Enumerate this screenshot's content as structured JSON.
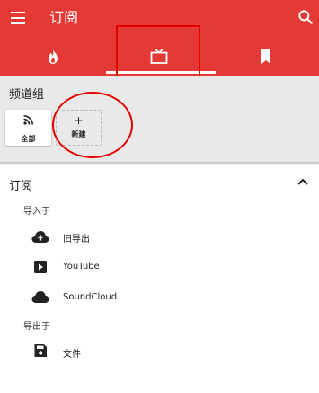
{
  "app": {
    "title": "订阅",
    "brand_color": "#e53935",
    "menu_icon": "menu-icon",
    "search_icon": "search-icon"
  },
  "tabs": [
    {
      "icon": "fire-icon",
      "selected": false
    },
    {
      "icon": "tv-icon",
      "selected": true
    },
    {
      "icon": "bookmark-icon",
      "selected": false
    }
  ],
  "channel_groups": {
    "title": "频道组",
    "items": [
      {
        "label": "全部",
        "icon": "rss-icon"
      },
      {
        "label": "新建",
        "icon": "plus-icon",
        "glyph": "+"
      }
    ]
  },
  "subscriptions": {
    "title": "订阅",
    "expanded_icon": "chevron-up-icon",
    "import_header": "导入于",
    "import_items": [
      {
        "label": "旧导出",
        "icon": "cloud-upload-icon"
      },
      {
        "label": "YouTube",
        "icon": "youtube-play-icon"
      },
      {
        "label": "SoundCloud",
        "icon": "cloud-icon"
      }
    ],
    "export_header": "导出于",
    "export_items": [
      {
        "label": "文件",
        "icon": "save-icon"
      }
    ]
  },
  "annotation_color": "#e50000"
}
